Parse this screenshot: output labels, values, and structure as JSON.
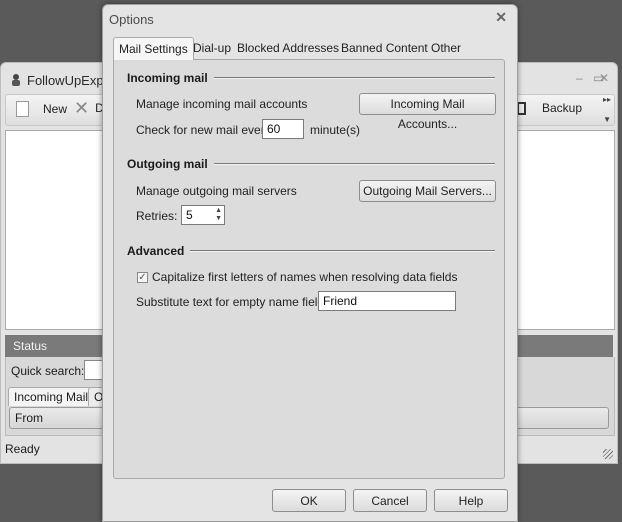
{
  "main_window": {
    "title": "FollowUpExpe",
    "toolbar": {
      "new_label": "New",
      "truncated_label": "D",
      "backup_label": "Backup"
    },
    "status_header": "Status",
    "quick_search_label": "Quick search:",
    "quick_search_value": "",
    "tabs": [
      {
        "label": "Incoming Mail",
        "active": true
      },
      {
        "label": "Ou",
        "active": false
      }
    ],
    "column_header": "From",
    "status_bar": "Ready"
  },
  "dialog": {
    "title": "Options",
    "tabs": [
      {
        "label": "Mail Settings",
        "active": true
      },
      {
        "label": "Dial-up",
        "active": false
      },
      {
        "label": "Blocked Addresses",
        "active": false
      },
      {
        "label": "Banned Content",
        "active": false
      },
      {
        "label": "Other",
        "active": false
      }
    ],
    "incoming": {
      "header": "Incoming mail",
      "manage_label": "Manage incoming mail accounts",
      "manage_button": "Incoming Mail Accounts...",
      "check_label": "Check for new mail every",
      "check_value": "60",
      "check_unit": "minute(s)"
    },
    "outgoing": {
      "header": "Outgoing mail",
      "manage_label": "Manage outgoing mail servers",
      "manage_button": "Outgoing Mail Servers...",
      "retries_label": "Retries:",
      "retries_value": "5"
    },
    "advanced": {
      "header": "Advanced",
      "capitalize_label": "Capitalize first letters of names when resolving data fields",
      "capitalize_checked": true,
      "substitute_label": "Substitute text for empty name field:",
      "substitute_value": "Friend"
    },
    "buttons": {
      "ok": "OK",
      "cancel": "Cancel",
      "help": "Help"
    }
  }
}
